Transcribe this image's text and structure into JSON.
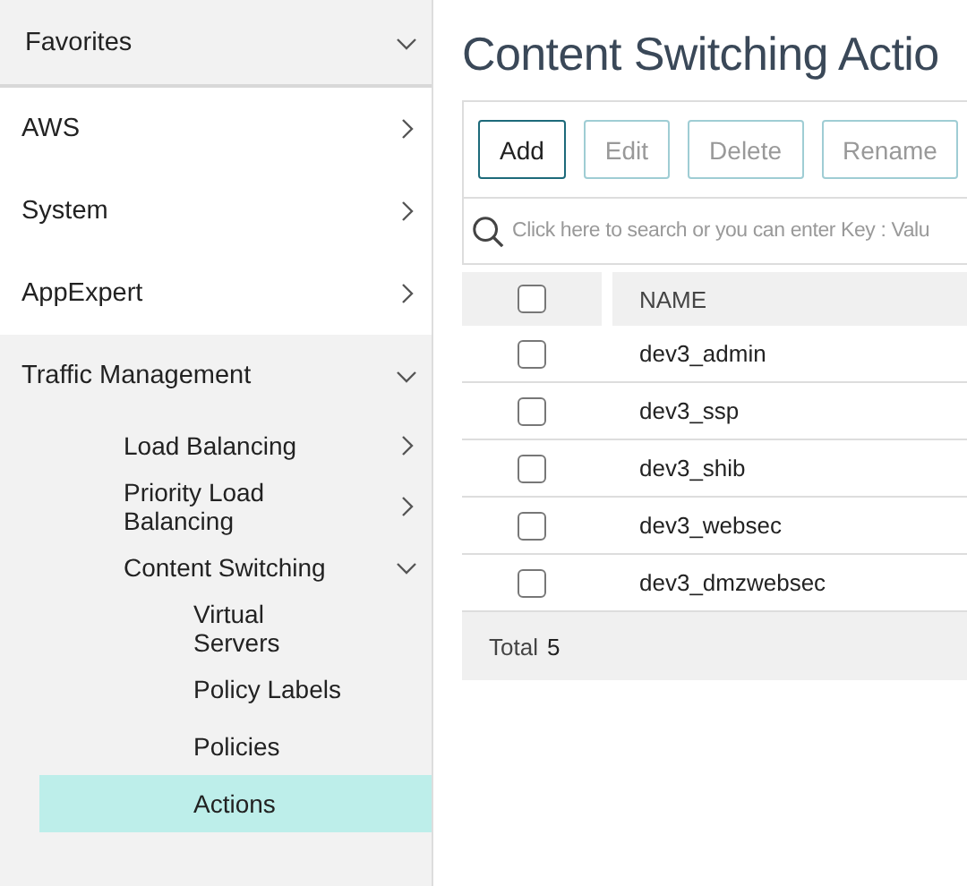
{
  "sidebar": {
    "items": [
      {
        "label": "Favorites",
        "expanded": true,
        "kind": "header"
      },
      {
        "label": "AWS",
        "expanded": false
      },
      {
        "label": "System",
        "expanded": false
      },
      {
        "label": "AppExpert",
        "expanded": false
      },
      {
        "label": "Traffic Management",
        "expanded": true,
        "children": [
          {
            "label": "Load Balancing",
            "expanded": false
          },
          {
            "label": "Priority Load Balancing",
            "expanded": false
          },
          {
            "label": "Content Switching",
            "expanded": true,
            "children": [
              {
                "label": "Virtual Servers",
                "selected": false
              },
              {
                "label": "Policy Labels",
                "selected": false
              },
              {
                "label": "Policies",
                "selected": false
              },
              {
                "label": "Actions",
                "selected": true
              }
            ]
          }
        ]
      }
    ]
  },
  "page": {
    "title": "Content Switching Actio"
  },
  "toolbar": [
    {
      "label": "Add",
      "disabled": false
    },
    {
      "label": "Edit",
      "disabled": true
    },
    {
      "label": "Delete",
      "disabled": true
    },
    {
      "label": "Rename",
      "disabled": true
    }
  ],
  "search": {
    "placeholder": "Click here to search or you can enter Key : Valu"
  },
  "table": {
    "columns": [
      "NAME"
    ],
    "header_checked": false,
    "rows": [
      {
        "name": "dev3_admin",
        "checked": false
      },
      {
        "name": "dev3_ssp",
        "checked": false
      },
      {
        "name": "dev3_shib",
        "checked": false
      },
      {
        "name": "dev3_websec",
        "checked": false
      },
      {
        "name": "dev3_dmzwebsec",
        "checked": false
      }
    ]
  },
  "footer": {
    "label": "Total",
    "count": "5"
  }
}
